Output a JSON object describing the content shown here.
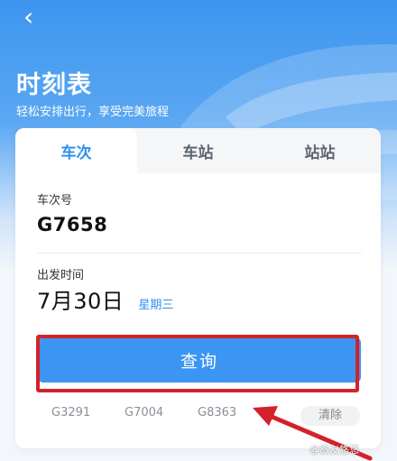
{
  "header": {
    "title": "时刻表",
    "subtitle": "轻松安排出行，享受完美旅程"
  },
  "tabs": [
    {
      "label": "车次",
      "active": true
    },
    {
      "label": "车站",
      "active": false
    },
    {
      "label": "站站",
      "active": false
    }
  ],
  "form": {
    "train_label": "车次号",
    "train_value": "G7658",
    "date_label": "出发时间",
    "date_value": "7月30日",
    "weekday": "星期三",
    "query_label": "查询"
  },
  "history": {
    "items": [
      "G3291",
      "G7004",
      "G8363"
    ],
    "clear_label": "清除"
  },
  "watermark": "@旅友悠悠",
  "colors": {
    "accent": "#3c95f2",
    "annotation": "#d3222a"
  },
  "icons": {
    "back": "back-arrow-icon"
  }
}
